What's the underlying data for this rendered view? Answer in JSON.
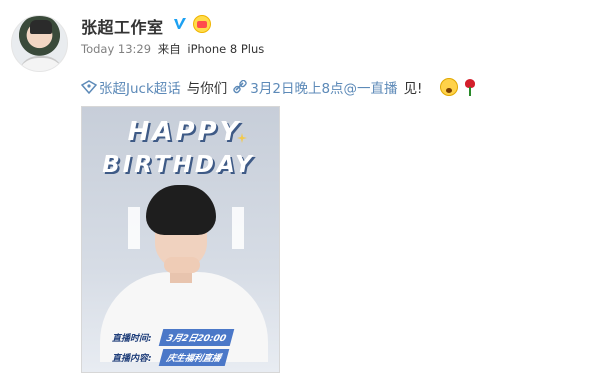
{
  "author": {
    "name": "张超工作室",
    "avatar": "avatar-photo",
    "badges": [
      "verified-icon",
      "vip-icon"
    ]
  },
  "meta": {
    "time": "Today 13:29",
    "source_prefix": "来自",
    "source": "iPhone 8 Plus"
  },
  "post": {
    "topic_tag": "张超Juck超话",
    "text_mid": "与你们",
    "link_tag": "3月2日晚上8点@一直播",
    "text_end": "见!",
    "emojis": [
      "surprised-face-icon",
      "rose-icon"
    ]
  },
  "poster": {
    "line1": "HAPPY",
    "line2": "BIRTHDAY",
    "info_time_label": "直播时间:",
    "info_time_value": "3月2日20:00",
    "info_content_label": "直播内容:",
    "info_content_value": "庆生福利直播"
  },
  "colors": {
    "link": "#5d8ab8",
    "meta": "#808080",
    "text": "#333333",
    "verified": "#1da1f2"
  }
}
